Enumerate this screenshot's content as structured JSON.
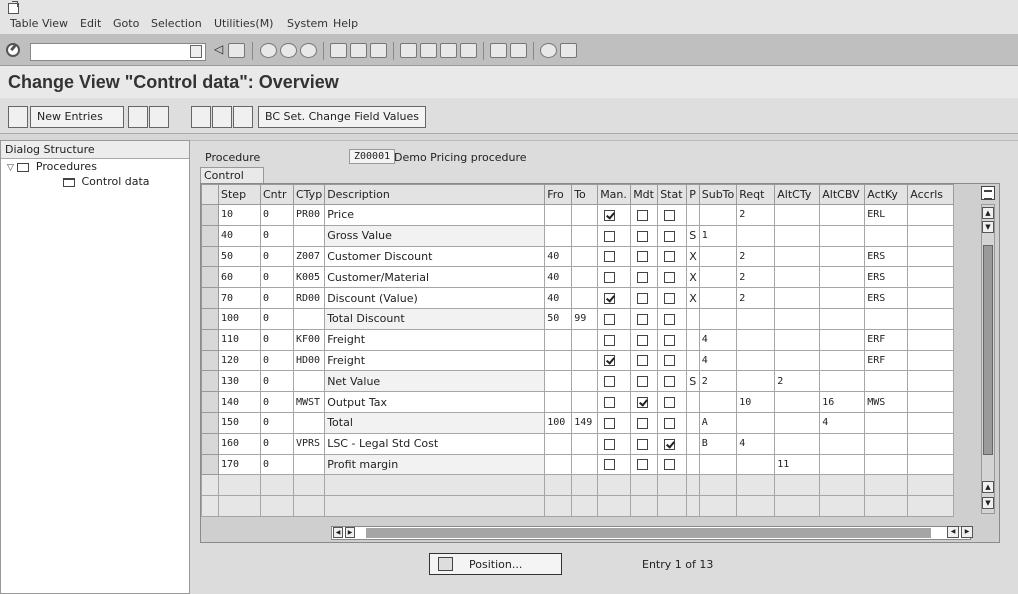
{
  "menubar": {
    "items": [
      "Table View",
      "Edit",
      "Goto",
      "Selection",
      "Utilities(M)",
      "System",
      "Help"
    ]
  },
  "std_toolbar": {
    "okcode_value": "",
    "icons": [
      "back-icon",
      "exit-icon",
      "cancel-icon",
      "print-icon",
      "find-icon",
      "find-next-icon",
      "first-page-icon",
      "prev-page-icon",
      "next-page-icon",
      "last-page-icon",
      "create-session-icon",
      "shortcut-icon",
      "help-icon",
      "layout-icon"
    ]
  },
  "title": "Change View \"Control data\": Overview",
  "app_toolbar": {
    "new_entries": "New Entries",
    "bc_set": "BC Set. Change Field Values"
  },
  "tree": {
    "title": "Dialog Structure",
    "procedures": "Procedures",
    "control_data": "Control data"
  },
  "procedure": {
    "label": "Procedure",
    "code": "Z00001",
    "description": "Demo Pricing procedure"
  },
  "tab": "Control data",
  "table": {
    "headers": [
      "Step",
      "Cntr",
      "CTyp",
      "Description",
      "Fro",
      "To",
      "Man.",
      "Mdt",
      "Stat",
      "P",
      "SubTo",
      "Reqt",
      "AltCTy",
      "AltCBV",
      "ActKy",
      "Accrls"
    ],
    "rows": [
      {
        "step": "10",
        "cntr": "0",
        "ctyp": "PR00",
        "desc": "Price",
        "fro": "",
        "to": "",
        "man": true,
        "mdt": false,
        "stat": false,
        "p": "",
        "subto": "",
        "reqt": "2",
        "altcty": "",
        "altcbv": "",
        "actky": "ERL",
        "accrls": ""
      },
      {
        "step": "40",
        "cntr": "0",
        "ctyp": "",
        "desc": "Gross Value",
        "fro": "",
        "to": "",
        "man": false,
        "mdt": false,
        "stat": false,
        "p": "S",
        "subto": "1",
        "reqt": "",
        "altcty": "",
        "altcbv": "",
        "actky": "",
        "accrls": ""
      },
      {
        "step": "50",
        "cntr": "0",
        "ctyp": "Z007",
        "desc": "Customer Discount",
        "fro": "40",
        "to": "",
        "man": false,
        "mdt": false,
        "stat": false,
        "p": "X",
        "subto": "",
        "reqt": "2",
        "altcty": "",
        "altcbv": "",
        "actky": "ERS",
        "accrls": ""
      },
      {
        "step": "60",
        "cntr": "0",
        "ctyp": "K005",
        "desc": "Customer/Material",
        "fro": "40",
        "to": "",
        "man": false,
        "mdt": false,
        "stat": false,
        "p": "X",
        "subto": "",
        "reqt": "2",
        "altcty": "",
        "altcbv": "",
        "actky": "ERS",
        "accrls": ""
      },
      {
        "step": "70",
        "cntr": "0",
        "ctyp": "RD00",
        "desc": "Discount (Value)",
        "fro": "40",
        "to": "",
        "man": true,
        "mdt": false,
        "stat": false,
        "p": "X",
        "subto": "",
        "reqt": "2",
        "altcty": "",
        "altcbv": "",
        "actky": "ERS",
        "accrls": ""
      },
      {
        "step": "100",
        "cntr": "0",
        "ctyp": "",
        "desc": "Total Discount",
        "fro": "50",
        "to": "99",
        "man": false,
        "mdt": false,
        "stat": false,
        "p": "",
        "subto": "",
        "reqt": "",
        "altcty": "",
        "altcbv": "",
        "actky": "",
        "accrls": ""
      },
      {
        "step": "110",
        "cntr": "0",
        "ctyp": "KF00",
        "desc": "Freight",
        "fro": "",
        "to": "",
        "man": false,
        "mdt": false,
        "stat": false,
        "p": "",
        "subto": "4",
        "reqt": "",
        "altcty": "",
        "altcbv": "",
        "actky": "ERF",
        "accrls": ""
      },
      {
        "step": "120",
        "cntr": "0",
        "ctyp": "HD00",
        "desc": "Freight",
        "fro": "",
        "to": "",
        "man": true,
        "mdt": false,
        "stat": false,
        "p": "",
        "subto": "4",
        "reqt": "",
        "altcty": "",
        "altcbv": "",
        "actky": "ERF",
        "accrls": ""
      },
      {
        "step": "130",
        "cntr": "0",
        "ctyp": "",
        "desc": "Net Value",
        "fro": "",
        "to": "",
        "man": false,
        "mdt": false,
        "stat": false,
        "p": "S",
        "subto": "2",
        "reqt": "",
        "altcty": "2",
        "altcbv": "",
        "actky": "",
        "accrls": ""
      },
      {
        "step": "140",
        "cntr": "0",
        "ctyp": "MWST",
        "desc": "Output Tax",
        "fro": "",
        "to": "",
        "man": false,
        "mdt": true,
        "stat": false,
        "p": "",
        "subto": "",
        "reqt": "10",
        "altcty": "",
        "altcbv": "16",
        "actky": "MWS",
        "accrls": ""
      },
      {
        "step": "150",
        "cntr": "0",
        "ctyp": "",
        "desc": "Total",
        "fro": "100",
        "to": "149",
        "man": false,
        "mdt": false,
        "stat": false,
        "p": "",
        "subto": "A",
        "reqt": "",
        "altcty": "",
        "altcbv": "4",
        "actky": "",
        "accrls": ""
      },
      {
        "step": "160",
        "cntr": "0",
        "ctyp": "VPRS",
        "desc": "LSC - Legal Std Cost",
        "fro": "",
        "to": "",
        "man": false,
        "mdt": false,
        "stat": true,
        "p": "",
        "subto": "B",
        "reqt": "4",
        "altcty": "",
        "altcbv": "",
        "actky": "",
        "accrls": ""
      },
      {
        "step": "170",
        "cntr": "0",
        "ctyp": "",
        "desc": "Profit margin",
        "fro": "",
        "to": "",
        "man": false,
        "mdt": false,
        "stat": false,
        "p": "",
        "subto": "",
        "reqt": "",
        "altcty": "11",
        "altcbv": "",
        "actky": "",
        "accrls": ""
      }
    ],
    "empty_rows": 2
  },
  "position_button": "Position...",
  "entry_info": "Entry 1 of 13"
}
